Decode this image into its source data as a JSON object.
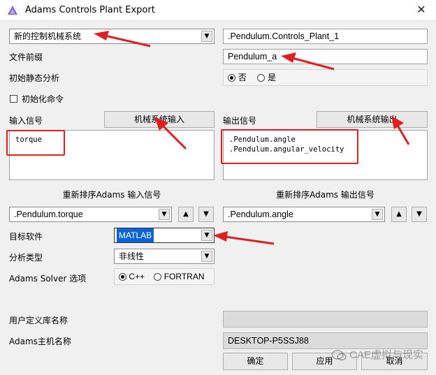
{
  "window": {
    "title": "Adams Controls Plant Export"
  },
  "plant_type": {
    "selected": "新的控制机械系统"
  },
  "plant_name": {
    "value": ".Pendulum.Controls_Plant_1"
  },
  "file_prefix": {
    "label": "文件前缀",
    "value": "Pendulum_a"
  },
  "initial_static": {
    "label": "初始静态分析",
    "options": [
      "否",
      "是"
    ],
    "selected": "否"
  },
  "init_commands": {
    "label": "初始化命令",
    "checked": false
  },
  "input_signals": {
    "label": "输入信号",
    "button": "机械系统输入",
    "items": [
      "torque"
    ]
  },
  "output_signals": {
    "label": "输出信号",
    "button": "机械系统输出",
    "items": [
      ".Pendulum.angle",
      ".Pendulum.angular_velocity"
    ]
  },
  "reorder_input": {
    "label": "重新排序Adams 输入信号",
    "selected": ".Pendulum.torque"
  },
  "reorder_output": {
    "label": "重新排序Adams 输出信号",
    "selected": ".Pendulum.angle"
  },
  "target_software": {
    "label": "目标软件",
    "selected": "MATLAB"
  },
  "analysis_type": {
    "label": "分析类型",
    "selected": "非线性"
  },
  "solver": {
    "label": "Adams Solver 选项",
    "options": [
      "C++",
      "FORTRAN"
    ],
    "selected": "C++"
  },
  "user_library": {
    "label": "用户定义库名称",
    "value": ""
  },
  "host_name": {
    "label": "Adams主机名称",
    "value": "DESKTOP-P5SSJ88"
  },
  "buttons": {
    "ok": "确定",
    "apply": "应用",
    "cancel": "取消"
  },
  "watermark": {
    "text": "CAE虚拟与现实"
  },
  "colors": {
    "selection": "#0a64d6",
    "annotation": "#e02020",
    "window_bg": "#f0f0f0"
  }
}
